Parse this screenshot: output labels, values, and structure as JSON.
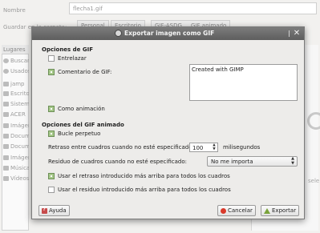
{
  "background": {
    "name_label": "Nombre",
    "name_value": "flecha1.gif",
    "save_label": "Guardar en la carpeta:",
    "path_buttons": [
      "Personal",
      "Escritorio",
      "GIF-ASDG ... GIF animado"
    ],
    "places_header": "Lugares",
    "places": [
      "Buscar",
      "Usados",
      "jamp",
      "Escritorio",
      "Sistema",
      "ACER",
      "Imágenes",
      "Documentos",
      "Documentos",
      "Imágenes",
      "Música",
      "Vídeos"
    ],
    "select_hint": "sele"
  },
  "dialog": {
    "title": "Exportar imagen como GIF",
    "gif_options": {
      "heading": "Opciones de GIF",
      "interlace_label": "Entrelazar",
      "interlace_checked": false,
      "comment_label": "Comentario de GIF:",
      "comment_checked": true,
      "comment_text": "Created with GIMP",
      "animation_label": "Como animación",
      "animation_checked": true
    },
    "anim_options": {
      "heading": "Opciones del GIF animado",
      "loop_label": "Bucle perpetuo",
      "loop_checked": true,
      "delay_label": "Retraso entre cuadros cuando no esté especificado:",
      "delay_value": "100",
      "delay_unit": "milisegundos",
      "disposal_label": "Residuo de cuadros cuando no esté especificado:",
      "disposal_value": "No me importa",
      "use_delay_label": "Usar el retraso introducido más arriba para todos los cuadros",
      "use_delay_checked": true,
      "use_disposal_label": "Usar el residuo introducido más arriba para todos los cuadros",
      "use_disposal_checked": false
    },
    "buttons": {
      "help": "Ayuda",
      "cancel": "Cancelar",
      "export": "Exportar"
    }
  },
  "colors": {
    "titlebar": "#6b6b6b",
    "checkbox_on": "#a6c88a",
    "cancel_icon": "#d93a2b",
    "export_icon": "#7aa33b"
  }
}
